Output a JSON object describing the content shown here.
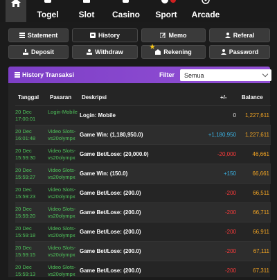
{
  "nav": [
    {
      "label": "",
      "icon": "home-icon",
      "active": true
    },
    {
      "label": "Togel",
      "icon": "lottery-icon",
      "active": false
    },
    {
      "label": "Slot",
      "icon": "slot-machine-icon",
      "active": false
    },
    {
      "label": "Casino",
      "icon": "dice-icon",
      "active": false
    },
    {
      "label": "Sport",
      "icon": "soccer-ball-icon",
      "active": false
    },
    {
      "label": "Arcade",
      "icon": "crosshair-icon",
      "active": false
    }
  ],
  "buttons": [
    {
      "label": "Statement",
      "icon": "list-icon",
      "active": false
    },
    {
      "label": "History",
      "icon": "history-icon",
      "active": true
    },
    {
      "label": "Memo",
      "icon": "edit-icon",
      "active": false
    },
    {
      "label": "Referal",
      "icon": "user-icon",
      "active": false
    },
    {
      "label": "Deposit",
      "icon": "deposit-icon",
      "active": false
    },
    {
      "label": "Withdraw",
      "icon": "withdraw-icon",
      "active": false
    },
    {
      "label": "Rekening",
      "icon": "bank-icon",
      "active": false
    },
    {
      "label": "Password",
      "icon": "user-icon",
      "active": false
    }
  ],
  "panel": {
    "title": "History Transaksi",
    "filter_label": "Filter",
    "filter_value": "Semua"
  },
  "columns": [
    "Tanggal",
    "Pasaran",
    "Deskripsi",
    "+/-",
    "Balance"
  ],
  "rows": [
    {
      "date": "20 Dec 17:00:01",
      "pasaran": "Login-Mobile",
      "desc": "Login: Mobile",
      "amount": "0",
      "kind": "neutral",
      "balance": "1,227,611"
    },
    {
      "date": "20 Dec 16:01:48",
      "pasaran": "Video Slots-vs20olympx",
      "desc": "Game Win: (1,180,950.0)",
      "amount": "+1,180,950",
      "kind": "pos",
      "balance": "1,227,611"
    },
    {
      "date": "20 Dec 15:59:30",
      "pasaran": "Video Slots-vs20olympx",
      "desc": "Game Bet/Lose: (20,000.0)",
      "amount": "-20,000",
      "kind": "neg",
      "balance": "46,661"
    },
    {
      "date": "20 Dec 15:59:27",
      "pasaran": "Video Slots-vs20olympx",
      "desc": "Game Win: (150.0)",
      "amount": "+150",
      "kind": "pos",
      "balance": "66,661"
    },
    {
      "date": "20 Dec 15:59:23",
      "pasaran": "Video Slots-vs20olympx",
      "desc": "Game Bet/Lose: (200.0)",
      "amount": "-200",
      "kind": "neg",
      "balance": "66,511"
    },
    {
      "date": "20 Dec 15:59:20",
      "pasaran": "Video Slots-vs20olympx",
      "desc": "Game Bet/Lose: (200.0)",
      "amount": "-200",
      "kind": "neg",
      "balance": "66,711"
    },
    {
      "date": "20 Dec 15:59:18",
      "pasaran": "Video Slots-vs20olympx",
      "desc": "Game Bet/Lose: (200.0)",
      "amount": "-200",
      "kind": "neg",
      "balance": "66,911"
    },
    {
      "date": "20 Dec 15:59:15",
      "pasaran": "Video Slots-vs20olympx",
      "desc": "Game Bet/Lose: (200.0)",
      "amount": "-200",
      "kind": "neg",
      "balance": "67,111"
    },
    {
      "date": "20 Dec 15:59:13",
      "pasaran": "Video Slots-vs20olympx",
      "desc": "Game Bet/Lose: (200.0)",
      "amount": "-200",
      "kind": "neg",
      "balance": "67,311"
    }
  ],
  "colors": {
    "accent": "#8a48d0",
    "balance": "#f5a623",
    "positive": "#3bb4e6",
    "negative": "#ff3b3b",
    "link": "#4fc35b"
  }
}
